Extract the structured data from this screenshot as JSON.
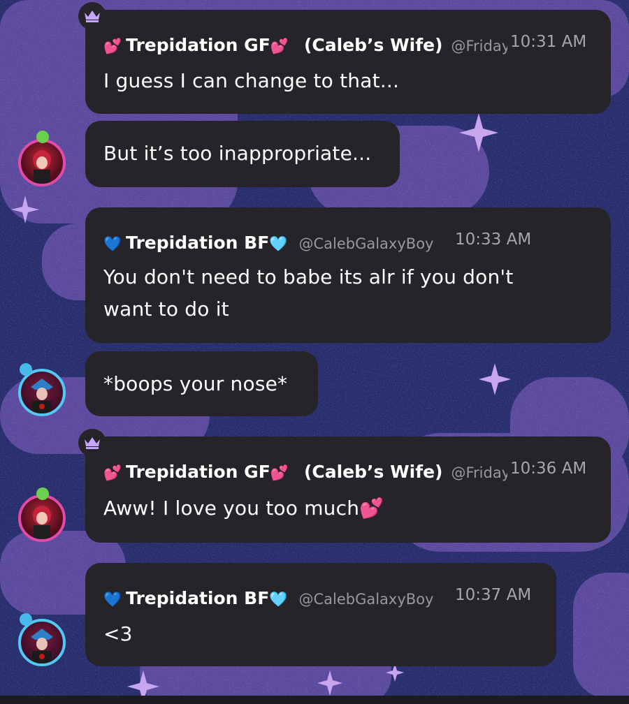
{
  "colors": {
    "background": "#2a2f6e",
    "cloud": "#5a4a9e",
    "bubble": "#262329",
    "text": "#ffffff",
    "muted": "#a7a5ad",
    "pink_heart": "#f04fa8",
    "blue_heart": "#3aa0ff",
    "crown": "#c7a6ff"
  },
  "messages": [
    {
      "sender": "Trepidation GF",
      "sender_emoji": "💕",
      "title": "(Caleb’s Wife)",
      "handle": "@Friday",
      "time": "10:31 AM",
      "lines": [
        "I guess I can change to that..."
      ],
      "crown_icon": "crown-icon"
    },
    {
      "lines": [
        "But it’s too inappropriate..."
      ],
      "avatar_icon": "gf-avatar"
    },
    {
      "sender": "Trepidation BF",
      "sender_emoji_left": "💙",
      "sender_emoji_right": "🩵",
      "handle": "@CalebGalaxyBoy",
      "time": "10:33 AM",
      "lines": [
        "You don't need to babe its alr if you don't",
        "want to do it"
      ]
    },
    {
      "lines": [
        "*boops your nose*"
      ],
      "avatar_icon": "bf-avatar"
    },
    {
      "sender": "Trepidation GF",
      "sender_emoji": "💕",
      "title": "(Caleb’s Wife)",
      "handle": "@Friday",
      "time": "10:36 AM",
      "lines": [
        "Aww! I love you too much💕"
      ],
      "crown_icon": "crown-icon"
    },
    {
      "sender": "Trepidation BF",
      "sender_emoji_left": "💙",
      "sender_emoji_right": "🩵",
      "handle": "@CalebGalaxyBoy",
      "time": "10:37 AM",
      "lines": [
        "<3"
      ],
      "avatar_icon": "bf-avatar"
    }
  ]
}
